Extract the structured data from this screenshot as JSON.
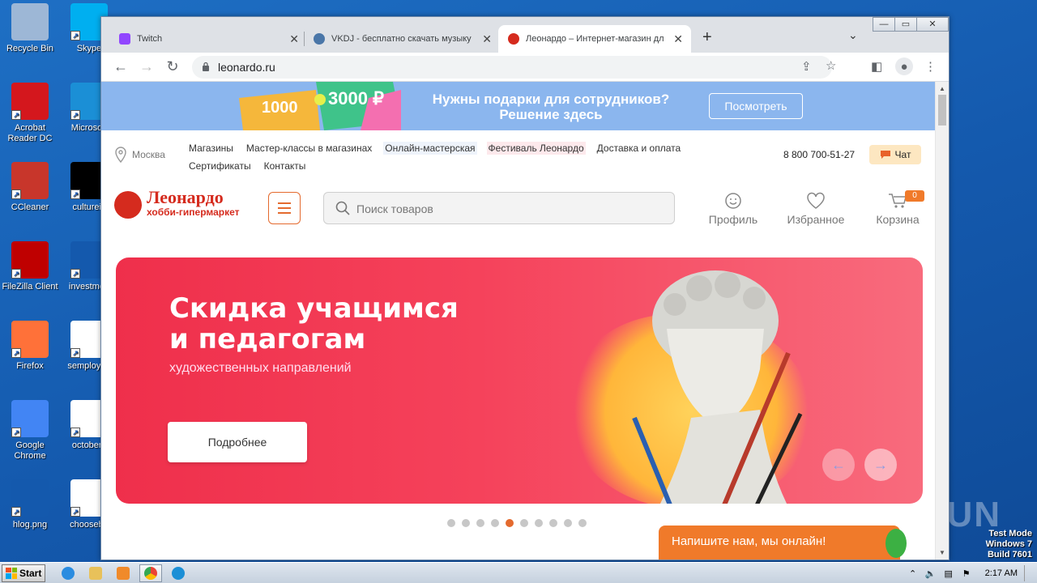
{
  "desktop": {
    "icons": [
      {
        "label": "Recycle Bin",
        "icon": "recycle-bin-icon",
        "color": "#9db7d6"
      },
      {
        "label": "Skype",
        "icon": "skype-icon",
        "color": "#00aff0"
      },
      {
        "label": "Acrobat Reader DC",
        "icon": "acrobat-icon",
        "color": "#d4171d"
      },
      {
        "label": "Microsoft",
        "icon": "edge-icon",
        "color": "#1b8fd6"
      },
      {
        "label": "CCleaner",
        "icon": "ccleaner-icon",
        "color": "#c8362b"
      },
      {
        "label": "cultureis",
        "icon": "file-icon",
        "color": "#000000"
      },
      {
        "label": "FileZilla Client",
        "icon": "filezilla-icon",
        "color": "#bf0000"
      },
      {
        "label": "investmen",
        "icon": "file-icon",
        "color": "#1459ad"
      },
      {
        "label": "Firefox",
        "icon": "firefox-icon",
        "color": "#ff7139"
      },
      {
        "label": "semployee",
        "icon": "word-icon",
        "color": "#ffffff"
      },
      {
        "label": "Google Chrome",
        "icon": "chrome-icon",
        "color": "#4285f4"
      },
      {
        "label": "octoberc",
        "icon": "word-icon",
        "color": "#ffffff"
      },
      {
        "label": "hlog.png",
        "icon": "image-file-icon",
        "color": "#1459ad"
      },
      {
        "label": "chooseba",
        "icon": "word-icon",
        "color": "#ffffff"
      }
    ],
    "watermark": "ANY RUN",
    "test_mode": [
      "Test Mode",
      "Windows 7",
      "Build 7601"
    ]
  },
  "taskbar": {
    "start_label": "Start",
    "clock": "2:17 AM"
  },
  "browser": {
    "tabs": [
      {
        "title": "Twitch",
        "icon": "twitch-icon",
        "color": "#9146ff"
      },
      {
        "title": "VKDJ - бесплатно скачать музыку",
        "icon": "vkdj-icon",
        "color": "#4a76a8"
      },
      {
        "title": "Леонардо – Интернет-магазин дл",
        "icon": "leonardo-icon",
        "color": "#d52b1e"
      }
    ],
    "url": "leonardo.ru"
  },
  "site": {
    "promo": {
      "amount_1": "1000",
      "amount_2": "3000 ₽",
      "line1": "Нужны подарки для сотрудников?",
      "line2": "Решение здесь",
      "button": "Посмотреть"
    },
    "city": "Москва",
    "nav_row1": [
      "Магазины",
      "Мастер-классы в магазинах",
      "Онлайн-мастерская",
      "Фестиваль Леонардо",
      "Доставка и оплата"
    ],
    "nav_row2": [
      "Сертификаты",
      "Контакты"
    ],
    "phone": "8 800 700-51-27",
    "chat": "Чат",
    "logo": {
      "name": "Леонардо",
      "tagline": "хобби-гипермаркет"
    },
    "search_placeholder": "Поиск товаров",
    "actions": {
      "profile": "Профиль",
      "favorites": "Избранное",
      "cart": "Корзина",
      "cart_count": "0"
    },
    "hero": {
      "title_line1": "Скидка учащимся",
      "title_line2": "и педагогам",
      "subtitle": "художественных направлений",
      "button": "Подробнее"
    },
    "slider": {
      "total": 10,
      "active_index": 4
    },
    "chat_widget": "Напишите нам, мы онлайн!"
  },
  "colors": {
    "accent": "#e46a2e",
    "brand_red": "#d52b1e",
    "promo_bg": "#8bb6ee",
    "hero_bg": "#f5425b"
  }
}
